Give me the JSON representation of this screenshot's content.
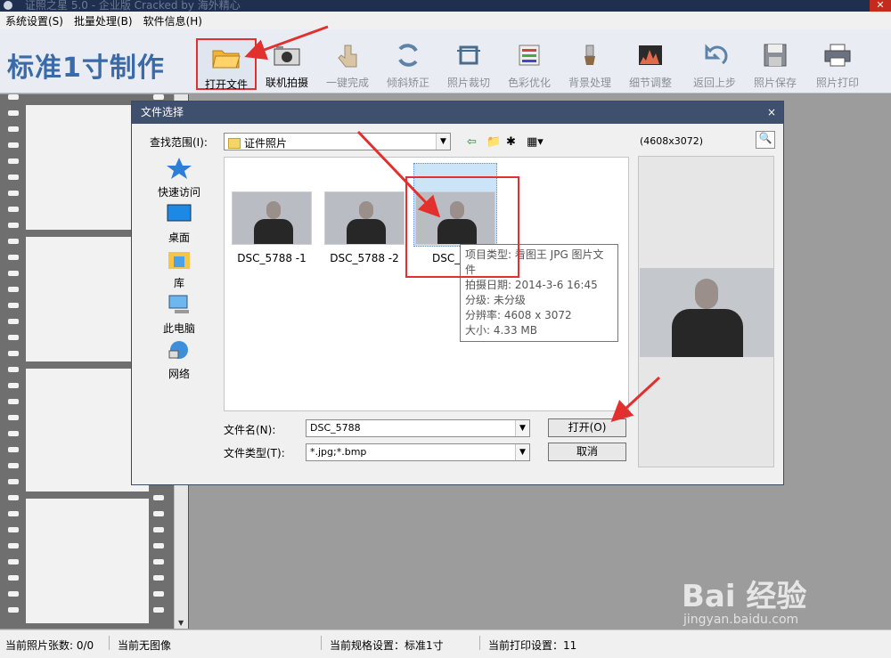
{
  "window": {
    "title": "证照之星 5.0 - 企业版 Cracked by 海外精心",
    "close_label": "✕"
  },
  "menu": [
    "系统设置(S)",
    "批量处理(B)",
    "软件信息(H)"
  ],
  "toolbar": {
    "brand": "标准1寸制作",
    "tools": [
      {
        "label": "打开文件",
        "icon": "folder-open-icon"
      },
      {
        "label": "联机拍摄",
        "icon": "camera-icon"
      },
      {
        "label": "一键完成",
        "icon": "hand-pointer-icon"
      },
      {
        "label": "倾斜矫正",
        "icon": "rotate-icon"
      },
      {
        "label": "照片裁切",
        "icon": "crop-icon"
      },
      {
        "label": "色彩优化",
        "icon": "color-sliders-icon"
      },
      {
        "label": "背景处理",
        "icon": "brush-icon"
      },
      {
        "label": "细节调整",
        "icon": "levels-icon"
      },
      {
        "label": "返回上步",
        "icon": "undo-icon"
      },
      {
        "label": "照片保存",
        "icon": "save-icon"
      },
      {
        "label": "照片打印",
        "icon": "printer-icon"
      }
    ]
  },
  "status": {
    "count": "当前照片张数: 0/0",
    "image": "当前无图像",
    "spec": "当前规格设置：标准1寸",
    "print": "当前打印设置：11"
  },
  "dialog": {
    "title": "文件选择",
    "close": "×",
    "look_in_label": "查找范围(I):",
    "look_in_value": "证件照片",
    "resolution": "(4608x3072)",
    "places": [
      "快速访问",
      "桌面",
      "库",
      "此电脑",
      "网络"
    ],
    "files": [
      "DSC_5788 -1",
      "DSC_5788 -2",
      "DSC_5"
    ],
    "tooltip": [
      "项目类型: 看图王 JPG 图片文件",
      "拍摄日期: 2014-3-6 16:45",
      "分级: 未分级",
      "分辨率: 4608 x 3072",
      "大小: 4.33 MB"
    ],
    "filename_label": "文件名(N):",
    "filename_value": "DSC_5788",
    "filetype_label": "文件类型(T):",
    "filetype_value": "*.jpg;*.bmp",
    "open_button": "打开(O)",
    "cancel_button": "取消"
  },
  "watermark": {
    "main": "Bai 经验",
    "sub": "jingyan.baidu.com"
  },
  "colors": {
    "annotation": "#e2302f",
    "dialog_title": "#3f4f6e",
    "brand": "#3b6aa8"
  }
}
